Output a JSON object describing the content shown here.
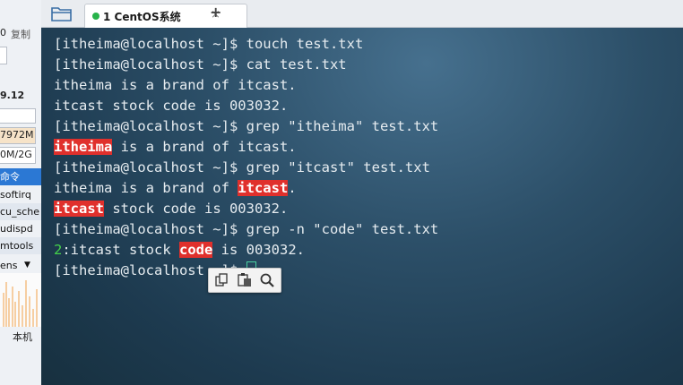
{
  "sidebar": {
    "top_left": "0",
    "copy_label": "复制",
    "version": "9.12",
    "mem_value": "7972M",
    "disk_value": "0M/2G",
    "command_header": "命令",
    "processes": [
      "softirq",
      "cu_sche",
      "udispd",
      "mtools"
    ],
    "network_label": "ens",
    "local_label": "本机"
  },
  "tabbar": {
    "tab_title": "1 CentOS系统",
    "close_symbol": "×",
    "new_tab_symbol": "+"
  },
  "terminal": {
    "lines": [
      {
        "segments": [
          {
            "text": "[itheima@localhost ~]$ touch test.txt",
            "style": "normal"
          }
        ]
      },
      {
        "segments": [
          {
            "text": "[itheima@localhost ~]$ cat test.txt",
            "style": "normal"
          }
        ]
      },
      {
        "segments": [
          {
            "text": "itheima is a brand of itcast.",
            "style": "normal"
          }
        ]
      },
      {
        "segments": [
          {
            "text": "itcast stock code is 003032.",
            "style": "normal"
          }
        ]
      },
      {
        "segments": [
          {
            "text": "[itheima@localhost ~]$ grep \"itheima\" test.txt",
            "style": "normal"
          }
        ]
      },
      {
        "segments": [
          {
            "text": "itheima",
            "style": "hl"
          },
          {
            "text": " is a brand of itcast.",
            "style": "normal"
          }
        ]
      },
      {
        "segments": [
          {
            "text": "[itheima@localhost ~]$ grep \"itcast\" test.txt",
            "style": "normal"
          }
        ]
      },
      {
        "segments": [
          {
            "text": "itheima is a brand of ",
            "style": "normal"
          },
          {
            "text": "itcast",
            "style": "hl"
          },
          {
            "text": ".",
            "style": "normal"
          }
        ]
      },
      {
        "segments": [
          {
            "text": "itcast",
            "style": "hl"
          },
          {
            "text": " stock code is 003032.",
            "style": "normal"
          }
        ]
      },
      {
        "segments": [
          {
            "text": "[itheima@localhost ~]$ grep -n \"code\" test.txt",
            "style": "normal"
          }
        ]
      },
      {
        "segments": [
          {
            "text": "2",
            "style": "num"
          },
          {
            "text": ":itcast stock ",
            "style": "normal"
          },
          {
            "text": "code",
            "style": "hl"
          },
          {
            "text": " is 003032.",
            "style": "normal"
          }
        ]
      },
      {
        "segments": [
          {
            "text": "[itheima@localhost ~]$ ",
            "style": "normal"
          },
          {
            "text": "",
            "style": "cursor"
          }
        ]
      }
    ]
  },
  "popup": {
    "buttons": [
      "copy-icon",
      "paste-icon",
      "search-icon"
    ]
  },
  "colors": {
    "highlight": "#e0302c",
    "line_number": "#44d34a",
    "terminal_text": "#e6ecf0"
  }
}
